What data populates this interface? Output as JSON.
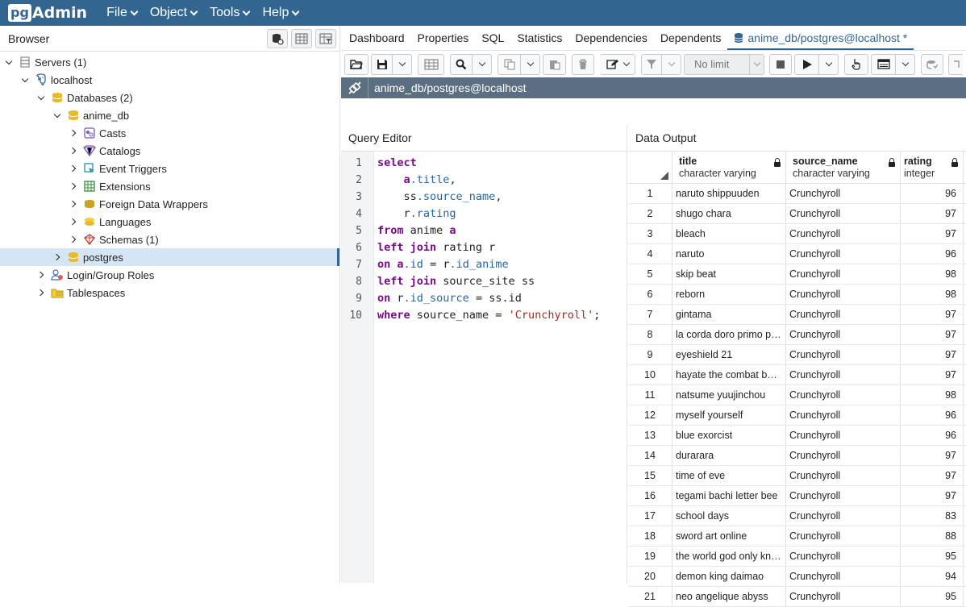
{
  "app": {
    "logo_pg": "pg",
    "logo_admin": "Admin",
    "menus": [
      "File",
      "Object",
      "Tools",
      "Help"
    ]
  },
  "browser": {
    "title": "Browser",
    "tree": [
      {
        "label": "Servers (1)",
        "level": 0,
        "expanded": true,
        "icon": "servers-icon"
      },
      {
        "label": "localhost",
        "level": 1,
        "expanded": true,
        "icon": "elephant-icon"
      },
      {
        "label": "Databases (2)",
        "level": 2,
        "expanded": true,
        "icon": "databases-icon"
      },
      {
        "label": "anime_db",
        "level": 3,
        "expanded": true,
        "icon": "database-icon"
      },
      {
        "label": "Casts",
        "level": 4,
        "expanded": false,
        "icon": "casts-icon"
      },
      {
        "label": "Catalogs",
        "level": 4,
        "expanded": false,
        "icon": "catalogs-icon"
      },
      {
        "label": "Event Triggers",
        "level": 4,
        "expanded": false,
        "icon": "event-triggers-icon"
      },
      {
        "label": "Extensions",
        "level": 4,
        "expanded": false,
        "icon": "extensions-icon"
      },
      {
        "label": "Foreign Data Wrappers",
        "level": 4,
        "expanded": false,
        "icon": "fdw-icon"
      },
      {
        "label": "Languages",
        "level": 4,
        "expanded": false,
        "icon": "languages-icon"
      },
      {
        "label": "Schemas (1)",
        "level": 4,
        "expanded": false,
        "icon": "schemas-icon"
      },
      {
        "label": "postgres",
        "level": 3,
        "expanded": false,
        "icon": "database-icon",
        "selected": true
      },
      {
        "label": "Login/Group Roles",
        "level": 2,
        "expanded": false,
        "icon": "roles-icon"
      },
      {
        "label": "Tablespaces",
        "level": 2,
        "expanded": false,
        "icon": "tablespaces-icon"
      }
    ]
  },
  "tabs": [
    "Dashboard",
    "Properties",
    "SQL",
    "Statistics",
    "Dependencies",
    "Dependents"
  ],
  "active_tab": "anime_db/postgres@localhost *",
  "toolbar": {
    "limit_label": "No limit"
  },
  "connection": "anime_db/postgres@localhost",
  "query_editor": {
    "title": "Query Editor",
    "lines": [
      [
        {
          "t": "select",
          "c": "kw"
        }
      ],
      [
        {
          "t": "    "
        },
        {
          "t": "a",
          "c": "kw"
        },
        {
          "t": ".title",
          "c": "fld"
        },
        {
          "t": ","
        }
      ],
      [
        {
          "t": "    ss"
        },
        {
          "t": ".source_name",
          "c": "fld"
        },
        {
          "t": ","
        }
      ],
      [
        {
          "t": "    r"
        },
        {
          "t": ".rating",
          "c": "fld"
        }
      ],
      [
        {
          "t": "from",
          "c": "kw"
        },
        {
          "t": " anime "
        },
        {
          "t": "a",
          "c": "kw"
        }
      ],
      [
        {
          "t": "left join",
          "c": "kw"
        },
        {
          "t": " rating r"
        }
      ],
      [
        {
          "t": "on",
          "c": "kw"
        },
        {
          "t": " "
        },
        {
          "t": "a",
          "c": "kw"
        },
        {
          "t": ".id",
          "c": "fld"
        },
        {
          "t": " = r"
        },
        {
          "t": ".id_anime",
          "c": "fld"
        }
      ],
      [
        {
          "t": "left join",
          "c": "kw"
        },
        {
          "t": " source_site ss"
        }
      ],
      [
        {
          "t": "on",
          "c": "kw"
        },
        {
          "t": " r"
        },
        {
          "t": ".id_source",
          "c": "fld"
        },
        {
          "t": " = ss.id"
        }
      ],
      [
        {
          "t": "where",
          "c": "kw"
        },
        {
          "t": " source_name = "
        },
        {
          "t": "'Crunchyroll'",
          "c": "str"
        },
        {
          "t": ";"
        }
      ]
    ]
  },
  "data_output": {
    "title": "Data Output",
    "columns": [
      {
        "name": "title",
        "type": "character varying"
      },
      {
        "name": "source_name",
        "type": "character varying"
      },
      {
        "name": "rating",
        "type": "integer"
      }
    ],
    "rows": [
      [
        "1",
        "naruto shippuuden",
        "Crunchyroll",
        "96"
      ],
      [
        "2",
        "shugo chara",
        "Crunchyroll",
        "97"
      ],
      [
        "3",
        "bleach",
        "Crunchyroll",
        "97"
      ],
      [
        "4",
        "naruto",
        "Crunchyroll",
        "96"
      ],
      [
        "5",
        "skip beat",
        "Crunchyroll",
        "98"
      ],
      [
        "6",
        "reborn",
        "Crunchyroll",
        "98"
      ],
      [
        "7",
        "gintama",
        "Crunchyroll",
        "97"
      ],
      [
        "8",
        "la corda doro primo pa...",
        "Crunchyroll",
        "97"
      ],
      [
        "9",
        "eyeshield 21",
        "Crunchyroll",
        "97"
      ],
      [
        "10",
        "hayate the combat butl...",
        "Crunchyroll",
        "97"
      ],
      [
        "11",
        "natsume yuujinchou",
        "Crunchyroll",
        "98"
      ],
      [
        "12",
        "myself yourself",
        "Crunchyroll",
        "96"
      ],
      [
        "13",
        "blue exorcist",
        "Crunchyroll",
        "96"
      ],
      [
        "14",
        "durarara",
        "Crunchyroll",
        "97"
      ],
      [
        "15",
        "time of eve",
        "Crunchyroll",
        "97"
      ],
      [
        "16",
        "tegami bachi letter bee",
        "Crunchyroll",
        "97"
      ],
      [
        "17",
        "school days",
        "Crunchyroll",
        "83"
      ],
      [
        "18",
        "sword art online",
        "Crunchyroll",
        "88"
      ],
      [
        "19",
        "the world god only kno...",
        "Crunchyroll",
        "95"
      ],
      [
        "20",
        "demon king daimao",
        "Crunchyroll",
        "94"
      ],
      [
        "21",
        "neo angelique abyss",
        "Crunchyroll",
        "95"
      ]
    ]
  },
  "colors": {
    "navbar": "#326690",
    "connection_bar": "#5c6f80",
    "selected_row": "#d4e6f5",
    "keyword": "#7a0b8a",
    "field": "#2166a5",
    "string": "#a32b1b"
  }
}
